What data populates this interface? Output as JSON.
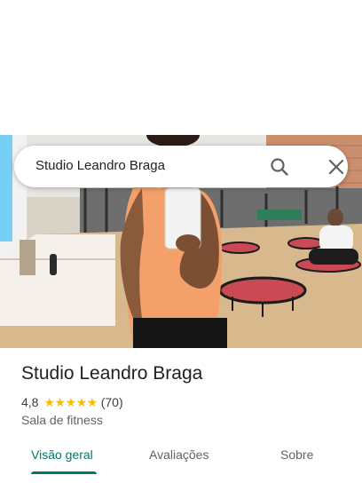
{
  "search": {
    "query": "Studio Leandro Braga",
    "search_icon": "search-icon",
    "close_icon": "close-icon"
  },
  "place": {
    "name": "Studio Leandro Braga",
    "rating": "4,8",
    "stars": "★★★★★",
    "reviews": "(70)",
    "category": "Sala de fitness"
  },
  "tabs": [
    {
      "label": "Visão geral"
    },
    {
      "label": "Avaliações"
    },
    {
      "label": "Sobre"
    }
  ],
  "colors": {
    "accent": "#00796b",
    "star": "#fbbc04"
  }
}
